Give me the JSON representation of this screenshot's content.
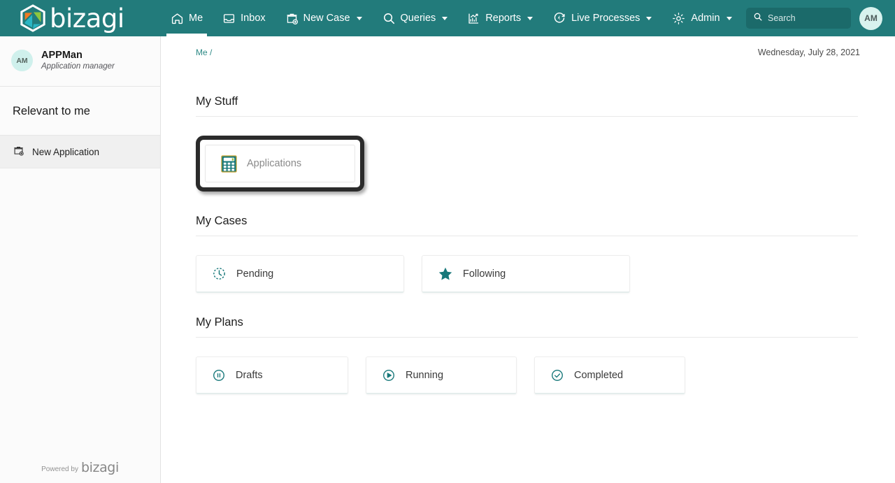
{
  "brand": {
    "word": "bizagi",
    "logo_icon": "bizagi-hexagon-logo"
  },
  "nav": {
    "items": [
      {
        "label": "Me",
        "icon": "home-icon",
        "caret": false,
        "active": true
      },
      {
        "label": "Inbox",
        "icon": "inbox-icon",
        "caret": false,
        "active": false
      },
      {
        "label": "New Case",
        "icon": "new-case-icon",
        "caret": true,
        "active": false
      },
      {
        "label": "Queries",
        "icon": "search-icon",
        "caret": true,
        "active": false
      },
      {
        "label": "Reports",
        "icon": "reports-chart-icon",
        "caret": true,
        "active": false
      },
      {
        "label": "Live Processes",
        "icon": "live-processes-icon",
        "caret": true,
        "active": false
      },
      {
        "label": "Admin",
        "icon": "gear-icon",
        "caret": true,
        "active": false
      }
    ],
    "search": {
      "placeholder": "Search",
      "icon": "search-icon",
      "value": ""
    },
    "avatar": {
      "initials": "AM"
    }
  },
  "sidebar": {
    "profile": {
      "initials": "AM",
      "name": "APPMan",
      "role": "Application manager"
    },
    "section_title": "Relevant to me",
    "items": [
      {
        "label": "New Application",
        "icon": "briefcase-plus-icon"
      }
    ],
    "footer": {
      "powered_by": "Powered by",
      "brand": "bizagi"
    }
  },
  "main": {
    "breadcrumb": "Me /",
    "date": "Wednesday, July 28, 2021",
    "sections": [
      {
        "title": "My Stuff",
        "cards": [
          {
            "label": "Applications",
            "icon": "calculator-icon",
            "highlighted": true
          }
        ]
      },
      {
        "title": "My Cases",
        "cards": [
          {
            "label": "Pending",
            "icon": "clock-icon",
            "highlighted": false
          },
          {
            "label": "Following",
            "icon": "star-icon",
            "highlighted": false
          }
        ]
      },
      {
        "title": "My Plans",
        "cards": [
          {
            "label": "Drafts",
            "icon": "pause-circle-icon",
            "highlighted": false
          },
          {
            "label": "Running",
            "icon": "play-circle-icon",
            "highlighted": false
          },
          {
            "label": "Completed",
            "icon": "check-circle-icon",
            "highlighted": false
          }
        ]
      }
    ]
  },
  "colors": {
    "brand_teal": "#227B7B",
    "search_teal": "#1B6A6A",
    "icon_teal": "#17787A",
    "breadcrumb_teal": "#2E8A86",
    "highlight_border": "#2B2B2B"
  }
}
